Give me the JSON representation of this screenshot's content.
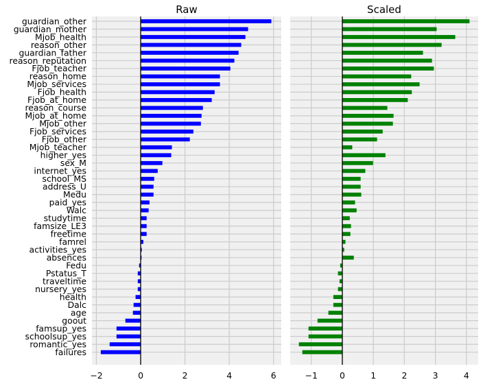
{
  "chart_data": [
    {
      "type": "bar",
      "orientation": "horizontal",
      "title": "Raw",
      "xlabel": "",
      "ylabel": "",
      "xlim": [
        -2.2,
        6.35
      ],
      "xticks": [
        -2,
        0,
        2,
        4,
        6
      ],
      "xtick_labels": [
        "−2",
        "0",
        "2",
        "4",
        "6"
      ],
      "grid": true,
      "bar_color": "#0000ff",
      "categories": [
        "guardian_other",
        "guardian_mother",
        "Mjob_health",
        "reason_other",
        "guardian_father",
        "reason_reputation",
        "Fjob_teacher",
        "reason_home",
        "Mjob_services",
        "Fjob_health",
        "Fjob_at_home",
        "reason_course",
        "Mjob_at_home",
        "Mjob_other",
        "Fjob_services",
        "Fjob_other",
        "Mjob_teacher",
        "higher_yes",
        "sex_M",
        "internet_yes",
        "school_MS",
        "address_U",
        "Medu",
        "paid_yes",
        "Walc",
        "studytime",
        "famsize_LE3",
        "freetime",
        "famrel",
        "activities_yes",
        "absences",
        "Fedu",
        "Pstatus_T",
        "traveltime",
        "nursery_yes",
        "health",
        "Dalc",
        "age",
        "goout",
        "famsup_yes",
        "schoolsup_yes",
        "romantic_yes",
        "failures"
      ],
      "values": [
        5.9,
        4.85,
        4.73,
        4.54,
        4.42,
        4.23,
        4.05,
        3.58,
        3.58,
        3.34,
        3.21,
        2.81,
        2.75,
        2.72,
        2.38,
        2.22,
        1.41,
        1.38,
        0.98,
        0.77,
        0.61,
        0.58,
        0.58,
        0.4,
        0.36,
        0.27,
        0.27,
        0.27,
        0.12,
        0.05,
        0.04,
        -0.07,
        -0.13,
        -0.13,
        -0.13,
        -0.23,
        -0.32,
        -0.35,
        -0.69,
        -1.09,
        -1.09,
        -1.4,
        -1.8
      ]
    },
    {
      "type": "bar",
      "orientation": "horizontal",
      "title": "Scaled",
      "xlabel": "",
      "ylabel": "",
      "xlim": [
        -1.68,
        4.38
      ],
      "xticks": [
        -1,
        0,
        1,
        2,
        3,
        4
      ],
      "xtick_labels": [
        "−1",
        "0",
        "1",
        "2",
        "3",
        "4"
      ],
      "grid": true,
      "bar_color": "#008000",
      "categories": [
        "guardian_other",
        "guardian_mother",
        "Mjob_health",
        "reason_other",
        "guardian_father",
        "reason_reputation",
        "Fjob_teacher",
        "reason_home",
        "Mjob_services",
        "Fjob_health",
        "Fjob_at_home",
        "reason_course",
        "Mjob_at_home",
        "Mjob_other",
        "Fjob_services",
        "Fjob_other",
        "Mjob_teacher",
        "higher_yes",
        "sex_M",
        "internet_yes",
        "school_MS",
        "address_U",
        "Medu",
        "paid_yes",
        "Walc",
        "studytime",
        "famsize_LE3",
        "freetime",
        "famrel",
        "activities_yes",
        "absences",
        "Fedu",
        "Pstatus_T",
        "traveltime",
        "nursery_yes",
        "health",
        "Dalc",
        "age",
        "goout",
        "famsup_yes",
        "schoolsup_yes",
        "romantic_yes",
        "failures"
      ],
      "values": [
        4.1,
        3.04,
        3.64,
        3.2,
        2.6,
        2.89,
        2.95,
        2.22,
        2.49,
        2.24,
        2.11,
        1.45,
        1.65,
        1.63,
        1.3,
        1.12,
        0.32,
        1.39,
        0.99,
        0.74,
        0.59,
        0.59,
        0.61,
        0.41,
        0.46,
        0.24,
        0.28,
        0.26,
        0.1,
        0.06,
        0.37,
        -0.07,
        -0.14,
        -0.09,
        -0.14,
        -0.29,
        -0.29,
        -0.45,
        -0.8,
        -1.09,
        -1.09,
        -1.4,
        -1.29
      ]
    }
  ]
}
